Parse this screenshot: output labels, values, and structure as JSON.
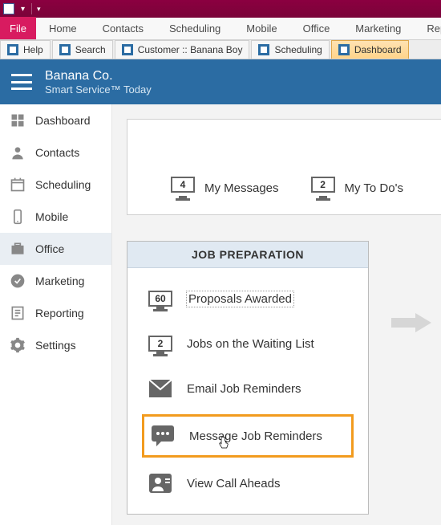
{
  "ribbon": {
    "file": "File",
    "tabs": [
      "Home",
      "Contacts",
      "Scheduling",
      "Mobile",
      "Office",
      "Marketing",
      "Reporting"
    ]
  },
  "doctabs": {
    "items": [
      {
        "label": "Help"
      },
      {
        "label": "Search"
      },
      {
        "label": "Customer :: Banana Boy"
      },
      {
        "label": "Scheduling"
      },
      {
        "label": "Dashboard",
        "active": true
      }
    ]
  },
  "header": {
    "title": "Banana Co.",
    "subtitle": "Smart Service™ Today"
  },
  "sidebar": {
    "items": [
      {
        "label": "Dashboard",
        "icon": "dashboard"
      },
      {
        "label": "Contacts",
        "icon": "contacts"
      },
      {
        "label": "Scheduling",
        "icon": "calendar"
      },
      {
        "label": "Mobile",
        "icon": "mobile"
      },
      {
        "label": "Office",
        "icon": "office",
        "active": true
      },
      {
        "label": "Marketing",
        "icon": "check"
      },
      {
        "label": "Reporting",
        "icon": "report"
      },
      {
        "label": "Settings",
        "icon": "gear"
      }
    ]
  },
  "top_stats": [
    {
      "count": "4",
      "label": "My Messages"
    },
    {
      "count": "2",
      "label": "My To Do's"
    }
  ],
  "job_prep": {
    "title": "JOB PREPARATION",
    "items": [
      {
        "count": "60",
        "label": "Proposals Awarded",
        "icon": "monitor",
        "selected": true
      },
      {
        "count": "2",
        "label": "Jobs on the Waiting List",
        "icon": "monitor"
      },
      {
        "label": "Email Job Reminders",
        "icon": "email"
      },
      {
        "label": "Message Job Reminders",
        "icon": "message",
        "highlight": true
      },
      {
        "label": "View Call Aheads",
        "icon": "person"
      }
    ]
  }
}
